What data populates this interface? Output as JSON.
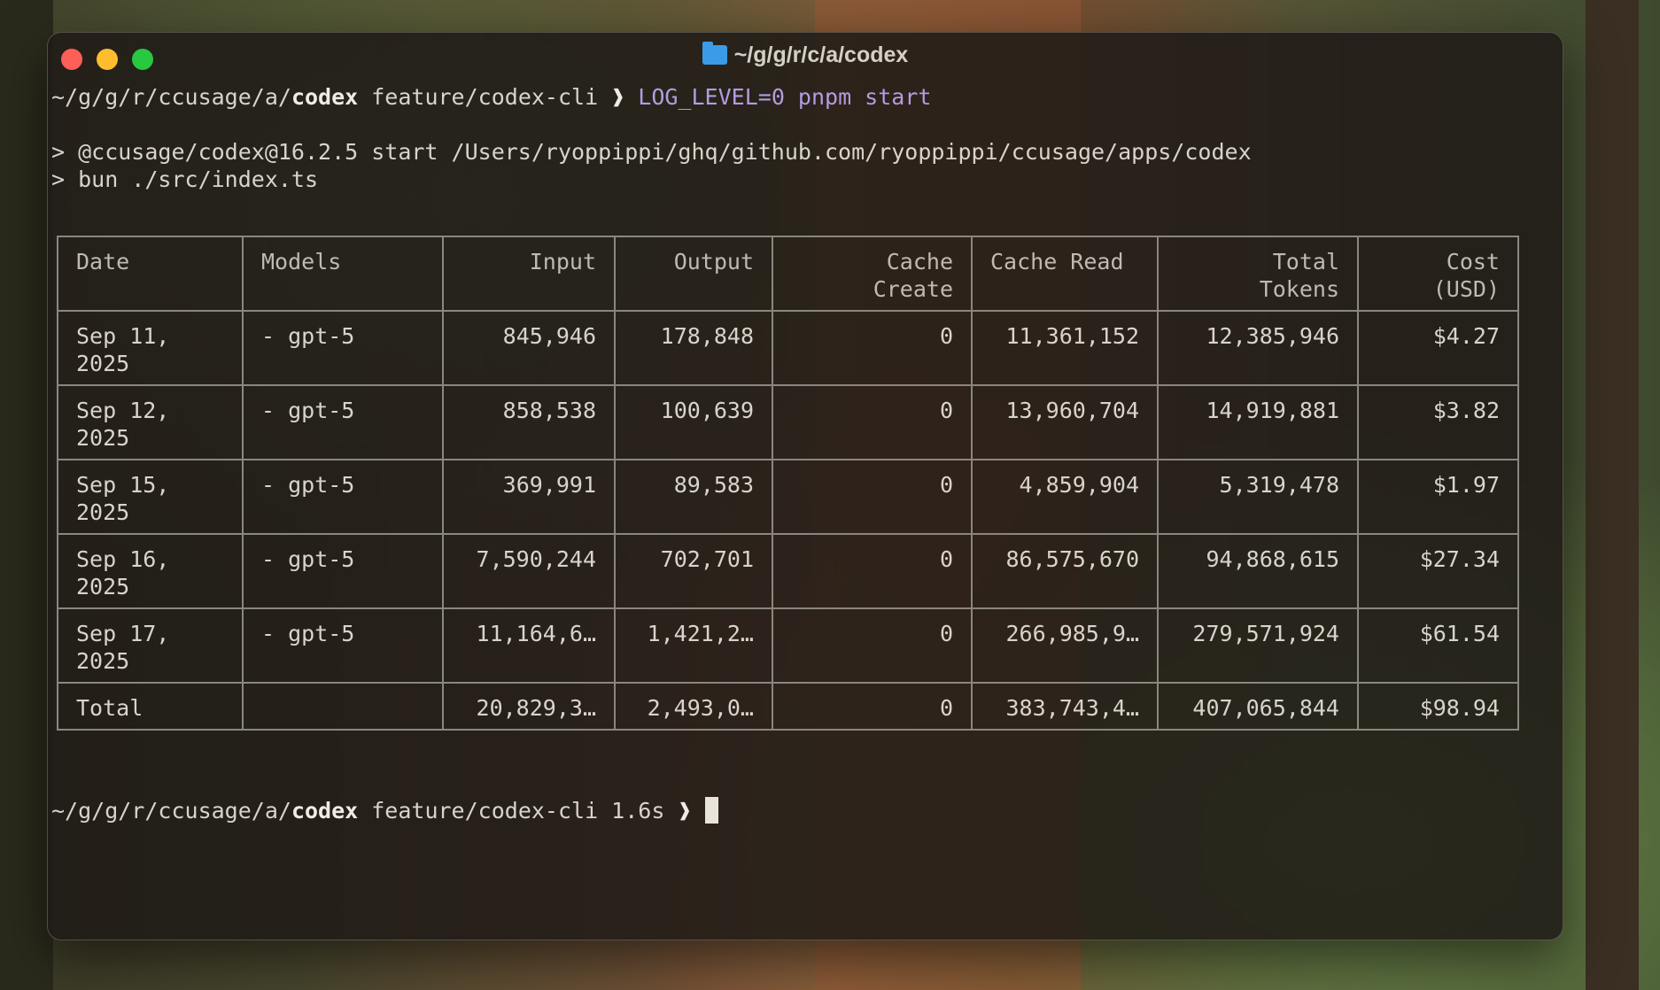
{
  "window": {
    "title": "~/g/g/r/c/a/codex"
  },
  "terminal": {
    "prompt1": {
      "path_prefix": "~/g/g/r/ccusage/a/",
      "path_dir": "codex",
      "branch": " feature/codex-cli ",
      "arrow": "❱",
      "command": " LOG_LEVEL=0 pnpm start"
    },
    "output_line1": "> @ccusage/codex@16.2.5 start /Users/ryoppippi/ghq/github.com/ryoppippi/ccusage/apps/codex",
    "output_line2": "> bun ./src/index.ts",
    "prompt2": {
      "path_prefix": "~/g/g/r/ccusage/a/",
      "path_dir": "codex",
      "branch": " feature/codex-cli 1.6s ",
      "arrow": "❱"
    }
  },
  "table": {
    "headers": [
      "Date",
      "Models",
      "Input",
      "Output",
      "Cache\nCreate",
      "Cache Read",
      "Total\nTokens",
      "Cost\n(USD)"
    ],
    "rows": [
      {
        "date": "Sep 11,\n2025",
        "model": "- gpt-5",
        "input": "845,946",
        "output": "178,848",
        "cache_create": "0",
        "cache_read": "11,361,152",
        "total_tokens": "12,385,946",
        "cost": "$4.27"
      },
      {
        "date": "Sep 12,\n2025",
        "model": "- gpt-5",
        "input": "858,538",
        "output": "100,639",
        "cache_create": "0",
        "cache_read": "13,960,704",
        "total_tokens": "14,919,881",
        "cost": "$3.82"
      },
      {
        "date": "Sep 15,\n2025",
        "model": "- gpt-5",
        "input": "369,991",
        "output": "89,583",
        "cache_create": "0",
        "cache_read": "4,859,904",
        "total_tokens": "5,319,478",
        "cost": "$1.97"
      },
      {
        "date": "Sep 16,\n2025",
        "model": "- gpt-5",
        "input": "7,590,244",
        "output": "702,701",
        "cache_create": "0",
        "cache_read": "86,575,670",
        "total_tokens": "94,868,615",
        "cost": "$27.34"
      },
      {
        "date": "Sep 17,\n2025",
        "model": "- gpt-5",
        "input": "11,164,6…",
        "output": "1,421,2…",
        "cache_create": "0",
        "cache_read": "266,985,9…",
        "total_tokens": "279,571,924",
        "cost": "$61.54"
      }
    ],
    "total": {
      "label": "Total",
      "model": "",
      "input": "20,829,3…",
      "output": "2,493,0…",
      "cache_create": "0",
      "cache_read": "383,743,4…",
      "total_tokens": "407,065,844",
      "cost": "$98.94"
    }
  },
  "colors": {
    "close": "#fe5f57",
    "minimize": "#febc2e",
    "maximize": "#28c840",
    "command": "#b49be0"
  }
}
